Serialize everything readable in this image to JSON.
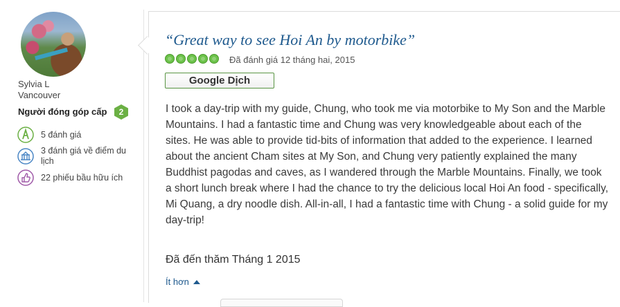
{
  "reviewer": {
    "name": "Sylvia L",
    "location": "Vancouver",
    "contributor_label": "Người đóng góp cấp",
    "level": "2",
    "stats": [
      {
        "icon": "pen-review-icon",
        "text": "5 đánh giá"
      },
      {
        "icon": "attraction-icon",
        "text": "3 đánh giá về điểm du lịch"
      },
      {
        "icon": "thumbs-up-icon",
        "text": "22 phiếu bầu hữu ích"
      }
    ]
  },
  "review": {
    "title": "“Great way to see Hoi An by motorbike”",
    "rating": 5,
    "rating_max": 5,
    "rated_date": "Đã đánh giá 12 tháng hai, 2015",
    "translate_label": "Google Dịch",
    "body": "I took a day-trip with my guide, Chung, who took me via motorbike to My Son and the Marble Mountains. I had a fantastic time and Chung was very knowledgeable about each of the sites. He was able to provide tid-bits of information that added to the experience. I learned about the ancient Cham sites at My Son, and Chung very patiently explained the many Buddhist pagodas and caves, as I wandered through the Marble Mountains. Finally, we took a short lunch break where I had the chance to try the delicious local Hoi An food - specifically, Mi Quang, a dry noodle dish. All-in-all, I had a fantastic time with Chung - a solid guide for my day-trip!",
    "visited": "Đã đến thăm Tháng 1 2015",
    "less_label": "Ít hơn"
  },
  "colors": {
    "bubble_green": "#6cc24a",
    "link_blue": "#1f5a8e",
    "badge_green": "#6bb044"
  }
}
